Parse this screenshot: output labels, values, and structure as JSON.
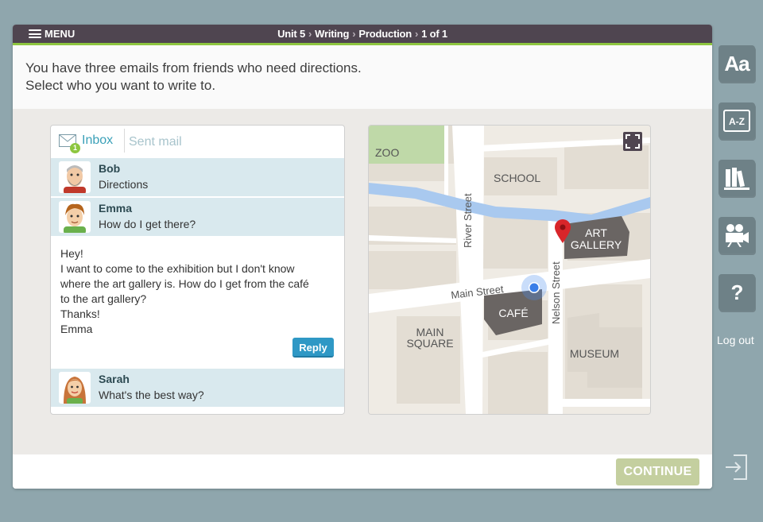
{
  "topbar": {
    "menu_label": "MENU",
    "breadcrumb": {
      "unit": "Unit 5",
      "section": "Writing",
      "activity": "Production",
      "page": "1 of 1"
    }
  },
  "instructions": {
    "line1": "You have three emails from friends who need directions.",
    "line2": "Select who you want to write to."
  },
  "email": {
    "tabs": {
      "inbox": "Inbox",
      "inbox_badge": "1",
      "sent": "Sent mail"
    },
    "messages": [
      {
        "sender": "Bob",
        "subject": "Directions"
      },
      {
        "sender": "Emma",
        "subject": "How do I get there?"
      },
      {
        "sender": "Sarah",
        "subject": "What's the best way?"
      }
    ],
    "open_message": {
      "lines": [
        "Hey!",
        "I want to come to the exhibition but I don't know",
        "where the art gallery is. How do I get from the café",
        "to the art gallery?",
        "Thanks!",
        "Emma"
      ],
      "reply_label": "Reply"
    }
  },
  "map": {
    "labels": {
      "zoo": "ZOO",
      "school": "SCHOOL",
      "art_gallery_1": "ART",
      "art_gallery_2": "GALLERY",
      "cafe": "CAFÉ",
      "main_square_1": "MAIN",
      "main_square_2": "SQUARE",
      "museum": "MUSEUM",
      "river_street": "River Street",
      "main_street": "Main Street",
      "nelson_street": "Nelson Street"
    }
  },
  "sidebar": {
    "buttons": [
      "font-size",
      "glossary",
      "library",
      "video",
      "help"
    ],
    "font_button_text": "Aa",
    "glossary_text": "A-Z",
    "help_text": "?",
    "logout_label": "Log out"
  },
  "footer": {
    "continue_label": "CONTINUE"
  },
  "colors": {
    "background": "#8fa6ad",
    "topbar": "#4f4550",
    "accent_green": "#8dc63f",
    "inbox_blue": "#3aa0b8",
    "message_row": "#d9e9ee",
    "reply_button": "#2f98c5",
    "continue_disabled": "#c4cf9f",
    "sidebar_button": "#6e8187",
    "river": "#a9c9ef"
  }
}
